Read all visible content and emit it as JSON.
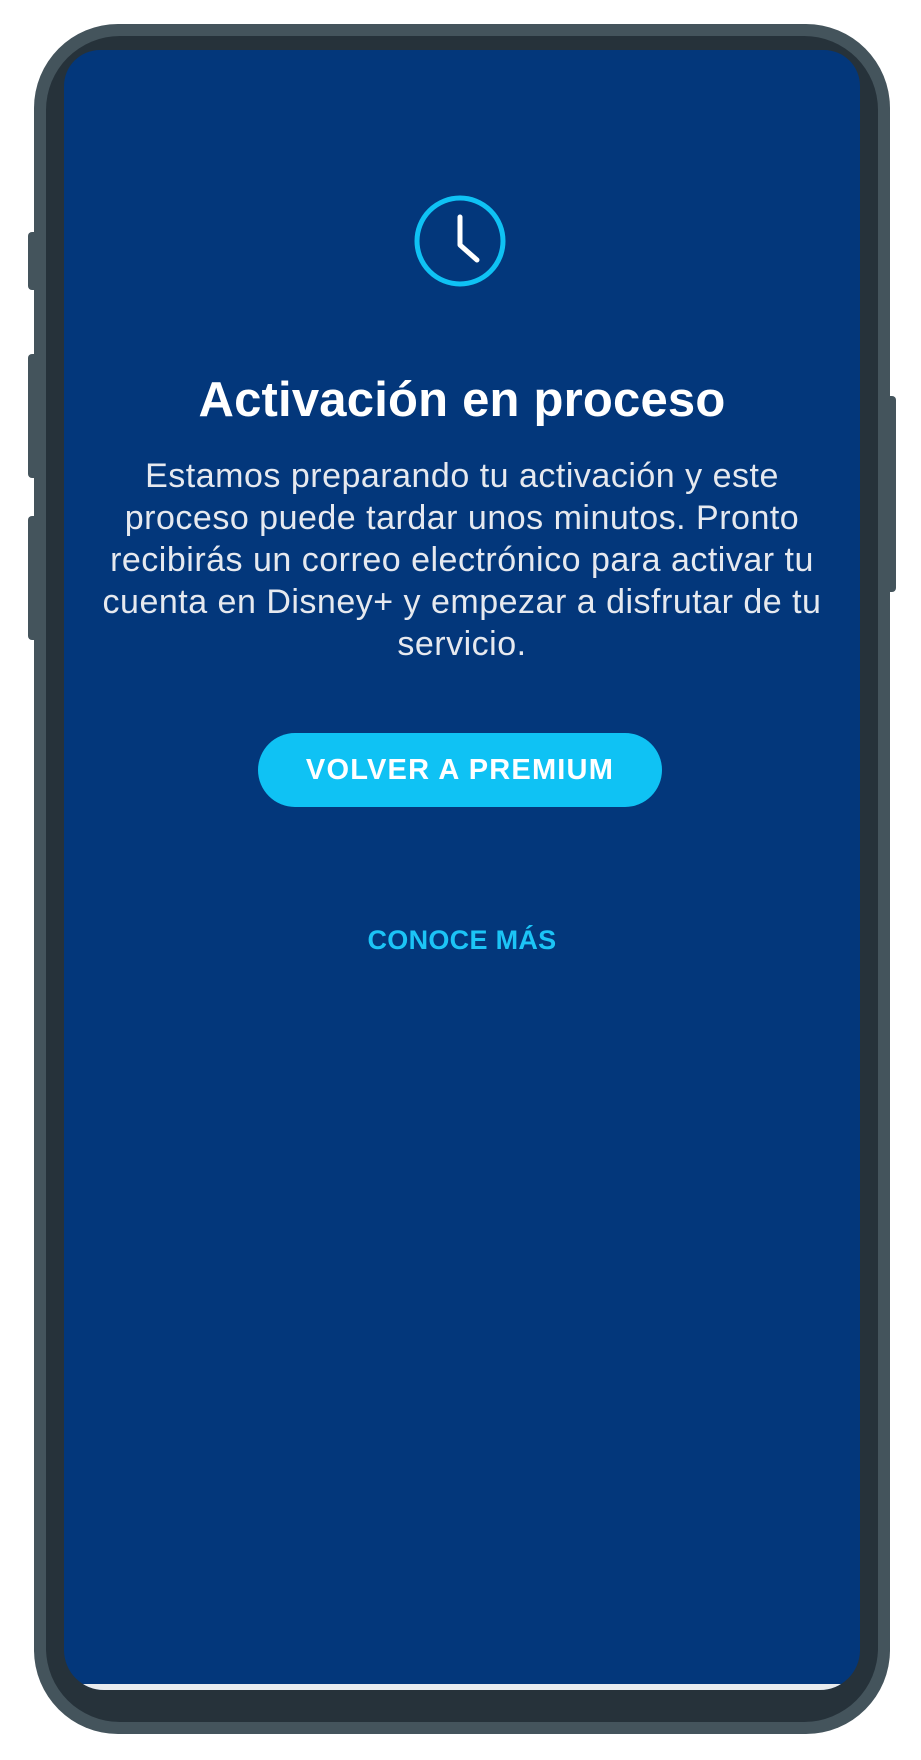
{
  "screen": {
    "icon": "clock-icon",
    "title": "Activación en proceso",
    "message": "Estamos preparando tu activación y este proceso puede tardar unos minutos. Pronto recibirás un correo electrónico para activar tu cuenta en Disney+ y empezar a disfrutar de tu servicio.",
    "primary_button_label": "VOLVER A PREMIUM",
    "secondary_link_label": "CONOCE MÁS"
  },
  "colors": {
    "background": "#03377b",
    "accent": "#0fc2f4",
    "phone_frame": "#44545c"
  }
}
